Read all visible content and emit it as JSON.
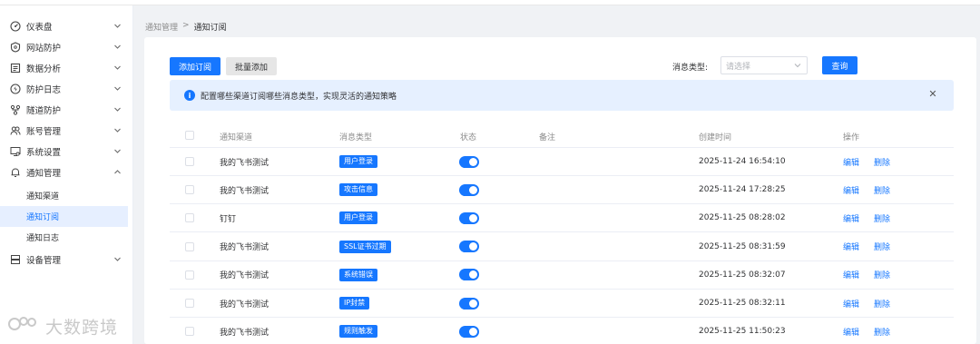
{
  "sidebar": {
    "items": [
      {
        "label": "仪表盘",
        "icon": "dashboard-gauge-icon"
      },
      {
        "label": "网站防护",
        "icon": "shield-icon"
      },
      {
        "label": "数据分析",
        "icon": "analytics-icon"
      },
      {
        "label": "防护日志",
        "icon": "log-icon"
      },
      {
        "label": "隧道防护",
        "icon": "tunnel-icon"
      },
      {
        "label": "账号管理",
        "icon": "users-icon"
      },
      {
        "label": "系统设置",
        "icon": "settings-icon"
      },
      {
        "label": "通知管理",
        "icon": "bell-icon"
      },
      {
        "label": "设备管理",
        "icon": "device-icon"
      }
    ],
    "sub_items": [
      "通知渠道",
      "通知订阅",
      "通知日志"
    ],
    "watermark": "大数跨境"
  },
  "breadcrumb": {
    "parent": "通知管理",
    "separator": ">",
    "current": "通知订阅"
  },
  "toolbar": {
    "add_label": "添加订阅",
    "batch_add_label": "批量添加",
    "filter_label": "消息类型:",
    "select_placeholder": "请选择",
    "query_label": "查询"
  },
  "alert": {
    "text": "配置哪些渠道订阅哪些消息类型，实现灵活的通知策略"
  },
  "table": {
    "headers": {
      "channel": "通知渠道",
      "type": "消息类型",
      "status": "状态",
      "remark": "备注",
      "created": "创建时间",
      "actions": "操作"
    },
    "rows": [
      {
        "channel": "我的飞书测试",
        "type": "用户登录",
        "status": true,
        "remark": "",
        "created": "2025-11-24 16:54:10"
      },
      {
        "channel": "我的飞书测试",
        "type": "攻击信息",
        "status": true,
        "remark": "",
        "created": "2025-11-24 17:28:25"
      },
      {
        "channel": "钉钉",
        "type": "用户登录",
        "status": true,
        "remark": "",
        "created": "2025-11-25 08:28:02"
      },
      {
        "channel": "我的飞书测试",
        "type": "SSL证书过期",
        "status": true,
        "remark": "",
        "created": "2025-11-25 08:31:59"
      },
      {
        "channel": "我的飞书测试",
        "type": "系统错误",
        "status": true,
        "remark": "",
        "created": "2025-11-25 08:32:07"
      },
      {
        "channel": "我的飞书测试",
        "type": "IP封禁",
        "status": true,
        "remark": "",
        "created": "2025-11-25 08:32:11"
      },
      {
        "channel": "我的飞书测试",
        "type": "规则触发",
        "status": true,
        "remark": "",
        "created": "2025-11-25 11:50:23"
      }
    ],
    "edit_label": "编辑",
    "delete_label": "删除"
  },
  "colors": {
    "primary": "#1677ff",
    "alert_bg": "#e6f0ff",
    "active_menu_bg": "#e6efff"
  }
}
